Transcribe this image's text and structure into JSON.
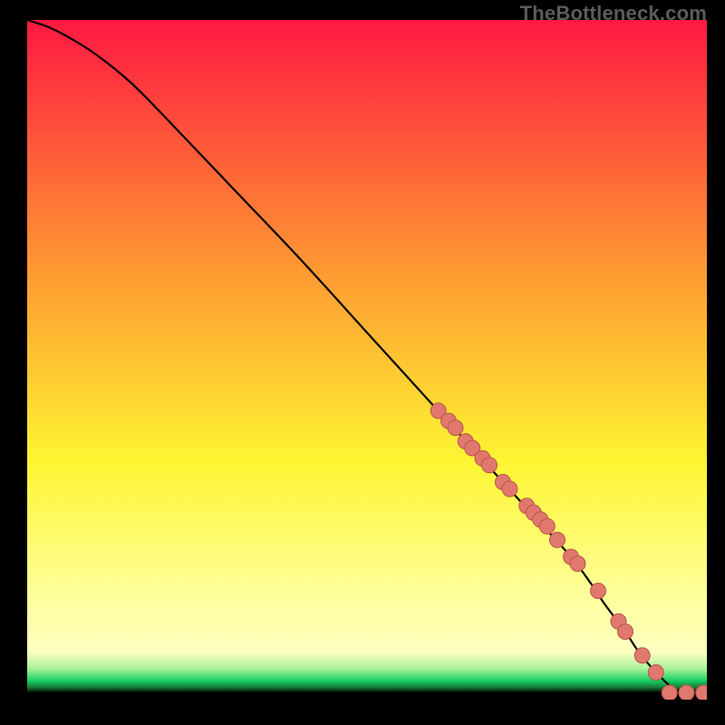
{
  "watermark": "TheBottleneck.com",
  "colors": {
    "marker_fill": "#e0786d",
    "marker_stroke": "#b9564c",
    "curve": "#000000",
    "bg_top": "#fe1841",
    "bg_mid1": "#fe9d32",
    "bg_mid2": "#fef532",
    "bg_mid3": "#feff98",
    "bg_mid4": "#a6f29a",
    "bg_green": "#18d064",
    "black": "#000000"
  },
  "chart_data": {
    "type": "line",
    "xlabel": "",
    "ylabel": "",
    "xlim": [
      0,
      100
    ],
    "ylim": [
      0,
      100
    ],
    "grid": false,
    "curve_x": [
      0,
      3,
      6,
      10,
      15,
      20,
      30,
      40,
      50,
      60,
      65,
      70,
      75,
      80,
      83,
      85,
      88,
      90,
      93,
      96,
      100
    ],
    "curve_y": [
      100,
      99,
      97.5,
      95,
      91,
      86,
      75.5,
      65,
      54,
      43,
      37.5,
      32,
      26.5,
      21,
      17,
      14,
      10,
      7,
      3.5,
      1.2,
      1.0
    ],
    "markers_x": [
      60.5,
      62,
      63,
      64.5,
      65.5,
      67,
      68,
      70,
      71,
      73.5,
      74.5,
      75.5,
      76.5,
      78,
      80,
      81,
      84,
      87,
      88,
      90.5,
      92.5,
      94.5,
      97,
      99.5
    ],
    "markers_y": [
      42.5,
      41,
      40,
      38,
      37,
      35.5,
      34.5,
      32,
      31,
      28.5,
      27.5,
      26.5,
      25.5,
      23.5,
      21,
      20,
      16,
      11.5,
      10,
      6.5,
      4,
      1.0,
      1.0,
      1.0
    ]
  }
}
